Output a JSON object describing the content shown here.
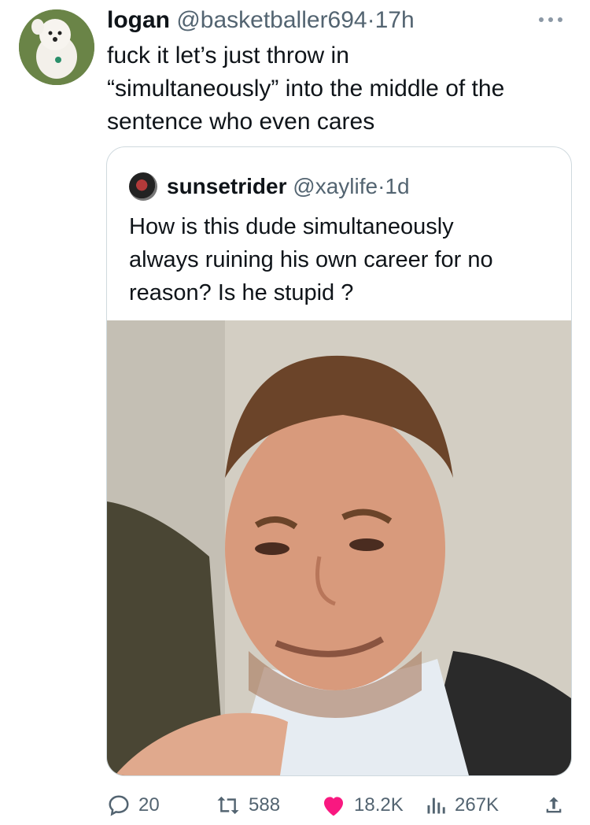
{
  "tweet": {
    "display_name": "logan",
    "handle": "@basketballer694",
    "separator": "·",
    "time": "17h",
    "text_line1": "fuck it let’s just throw in",
    "text_line2": "“simultaneously” into the middle of the",
    "text_line3": "sentence who even cares",
    "more_icon": "ellipsis-icon"
  },
  "quote": {
    "display_name": "sunsetrider",
    "handle": "@xaylife",
    "separator": "·",
    "time": "1d",
    "text_line1": "How is this dude simultaneously",
    "text_line2": "always ruining his own career for no",
    "text_line3": "reason? Is he stupid ?"
  },
  "actions": {
    "replies": "20",
    "retweets": "588",
    "likes": "18.2K",
    "views": "267K"
  },
  "colors": {
    "text": "#0f1419",
    "secondary": "#536471",
    "like": "#f91880",
    "border": "#cfd9de"
  }
}
